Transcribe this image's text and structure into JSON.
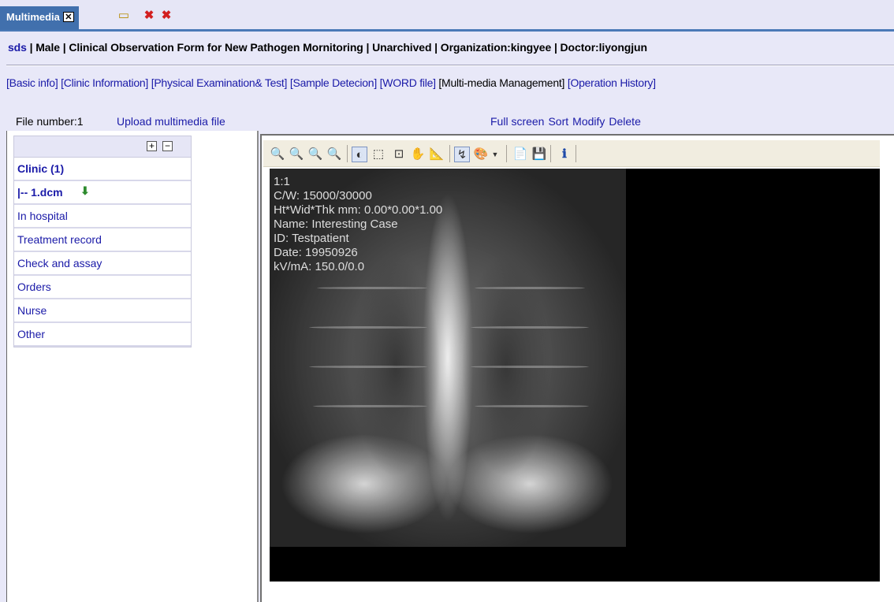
{
  "tabstrip": {
    "tab_label": "Multimedia",
    "tab_close": "✕"
  },
  "patient": {
    "name": "sds",
    "info": " | Male | Clinical Observation Form for New Pathogen Mornitoring | Unarchived | Organization:kingyee | Doctor:liyongjun"
  },
  "nav": {
    "basic": "[Basic info]",
    "clinic": "[Clinic Information]",
    "physical": "[Physical Examination& Test]",
    "sample": "[Sample Detecion]",
    "word": "[WORD file]",
    "multimedia": "[Multi-media Management]",
    "history": "[Operation History]"
  },
  "files": {
    "count_label": "File number:1",
    "upload_label": "Upload multimedia file"
  },
  "image_actions": {
    "fullscreen": "Full screen",
    "sort": "Sort",
    "modify": "Modify",
    "delete": "Delete"
  },
  "tree": {
    "expand": "+",
    "collapse": "−",
    "items": [
      {
        "label": "Clinic (1)"
      },
      {
        "label": "|-- 1.dcm"
      },
      {
        "label": "In hospital"
      },
      {
        "label": "Treatment record"
      },
      {
        "label": "Check and assay"
      },
      {
        "label": "Orders"
      },
      {
        "label": "Nurse"
      },
      {
        "label": "Other"
      }
    ]
  },
  "dicom_overlay": {
    "zoom": "1:1",
    "cw": "C/W: 15000/30000",
    "dims": "Ht*Wid*Thk mm: 0.00*0.00*1.00",
    "name": "Name: Interesting Case",
    "id": "ID: Testpatient",
    "date": "Date: 19950926",
    "kv": "kV/mA: 150.0/0.0"
  }
}
